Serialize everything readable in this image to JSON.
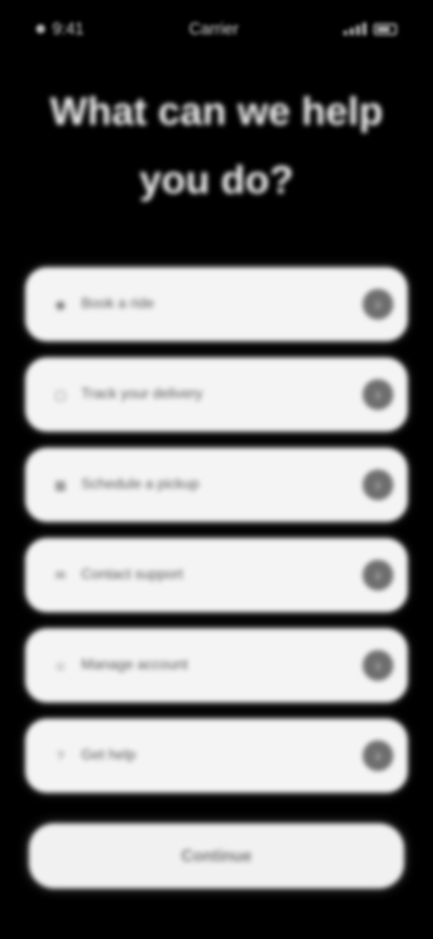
{
  "status_bar": {
    "time": "9:41",
    "center": "Carrier"
  },
  "heading": {
    "line1": "What can we help",
    "line2": "you do?"
  },
  "options": [
    {
      "label": "Book a ride",
      "icon": "car-icon"
    },
    {
      "label": "Track your delivery",
      "icon": "package-icon"
    },
    {
      "label": "Schedule a pickup",
      "icon": "calendar-icon"
    },
    {
      "label": "Contact support",
      "icon": "chat-icon"
    },
    {
      "label": "Manage account",
      "icon": "user-icon"
    },
    {
      "label": "Get help",
      "icon": "help-icon"
    }
  ],
  "continue_button": {
    "label": "Continue"
  },
  "colors": {
    "background": "#000000",
    "card": "#f4f4f4",
    "chevron": "#6e6e6e"
  }
}
